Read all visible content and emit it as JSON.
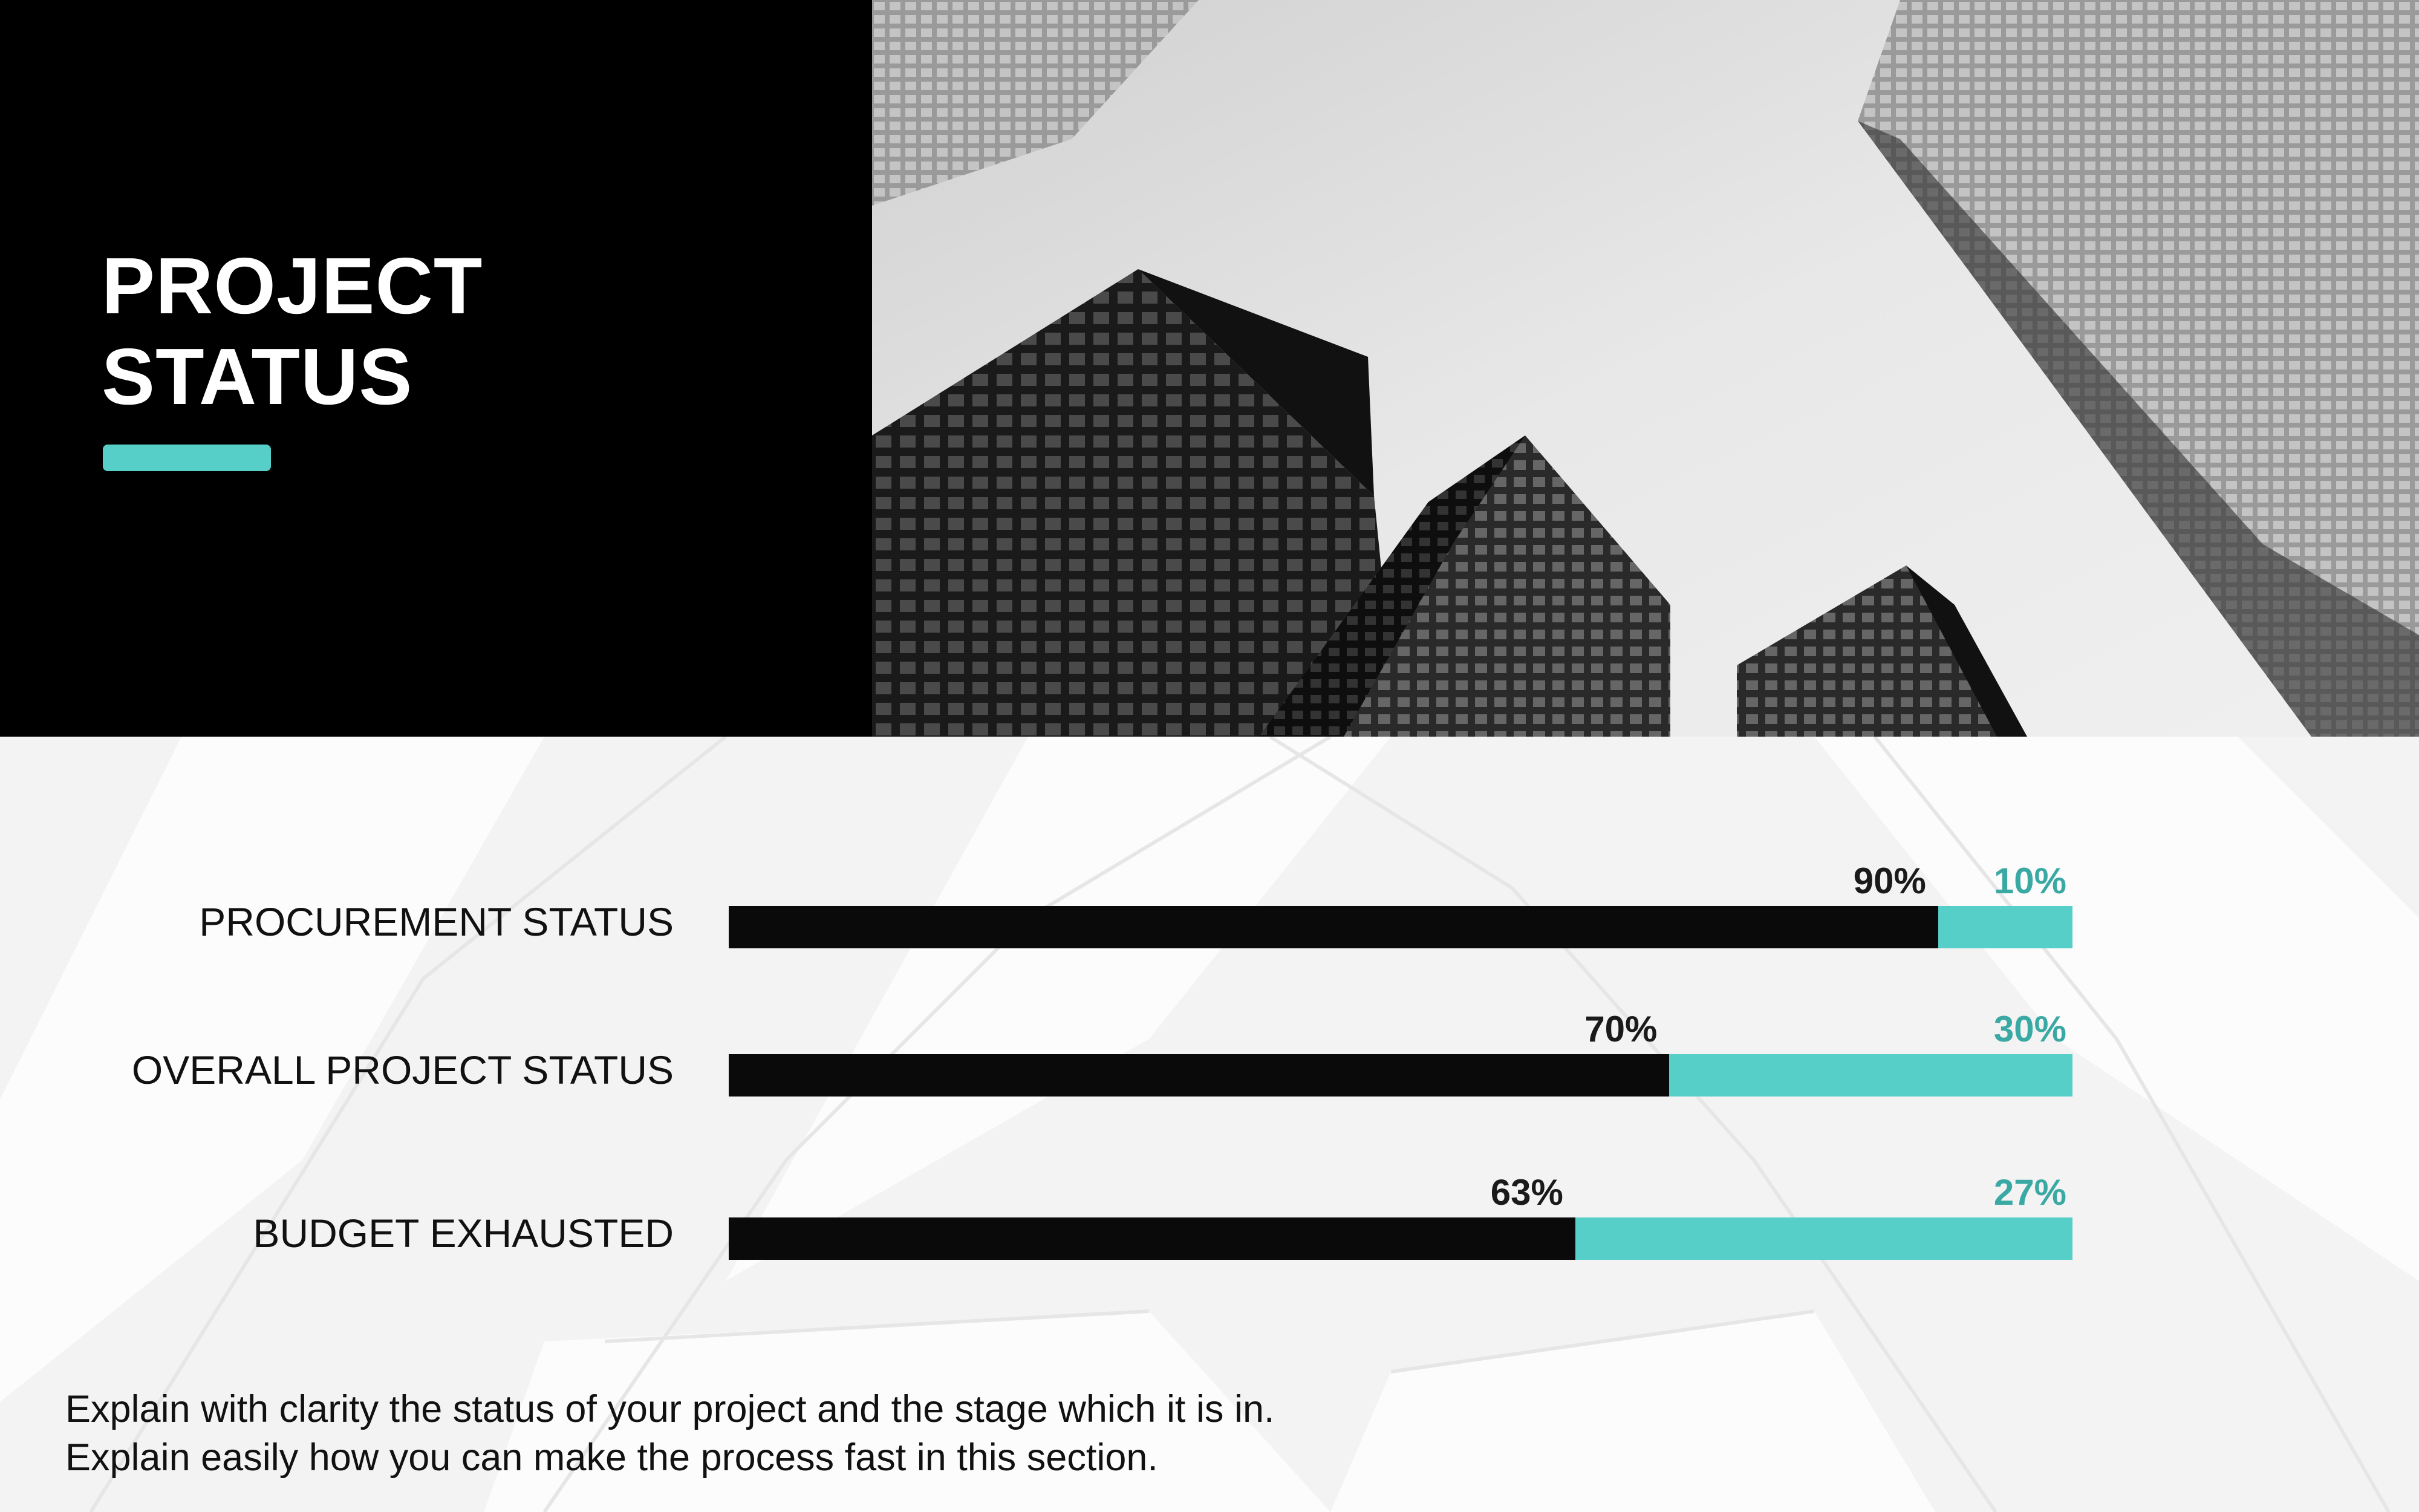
{
  "title": {
    "line1": "PROJECT",
    "line2": "STATUS"
  },
  "colors": {
    "accent": "#57cfc9",
    "accent_text": "#3aa9a4",
    "dark": "#0a0a0a",
    "panel": "#000000"
  },
  "photo": {
    "subject": "grayscale-skyscrapers"
  },
  "chart_data": {
    "type": "bar",
    "stacked": true,
    "orientation": "horizontal",
    "categories": [
      "PROCUREMENT STATUS",
      "OVERALL PROJECT STATUS",
      "BUDGET EXHAUSTED"
    ],
    "series": [
      {
        "values": [
          90,
          70,
          63
        ],
        "labels": [
          "90%",
          "70%",
          "63%"
        ]
      },
      {
        "values": [
          10,
          30,
          27
        ],
        "labels": [
          "10%",
          "30%",
          "27%"
        ]
      }
    ],
    "xlim": [
      0,
      100
    ],
    "grid": false
  },
  "footer": {
    "line1": "Explain with clarity the status of your project and the stage which it is in.",
    "line2": "Explain easily how you can make the process fast in this section."
  }
}
